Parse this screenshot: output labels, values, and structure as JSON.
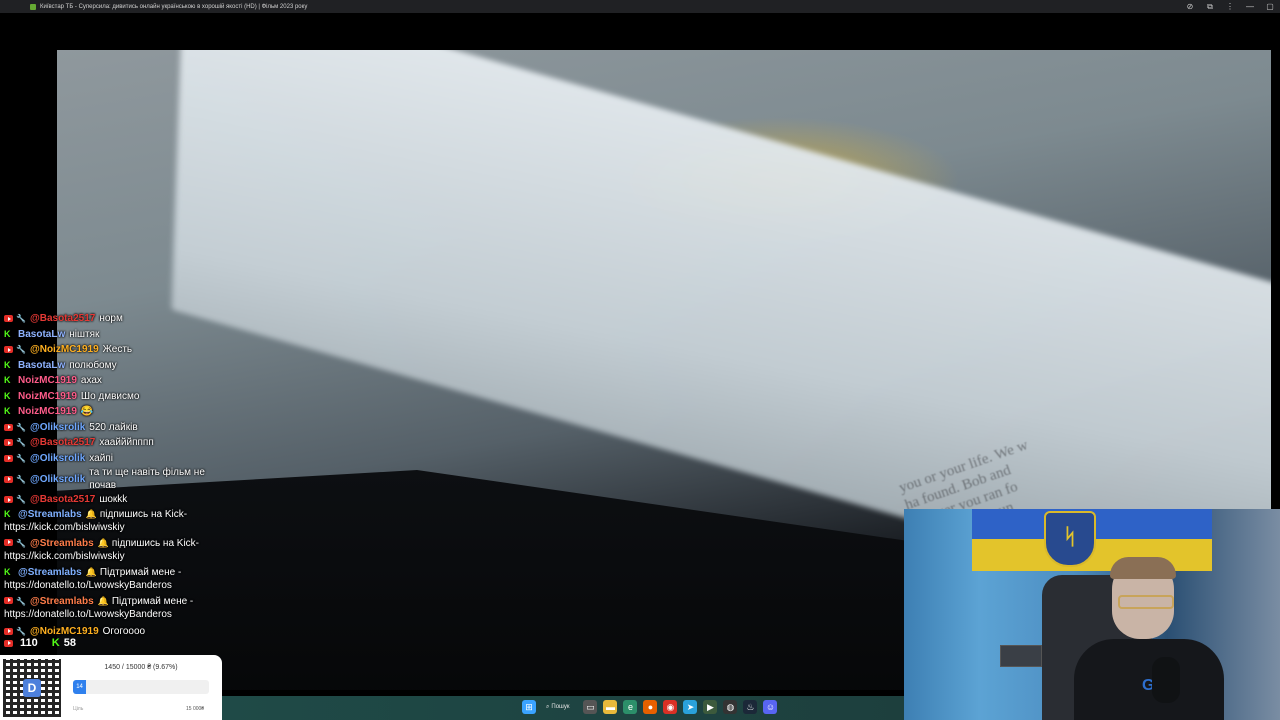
{
  "window": {
    "title": "Київстар ТБ - Суперсила: дивитись онлайн українською в хорошій якості (HD) | Фільм 2023 року",
    "controls": [
      "⊘",
      "⧉",
      "⋮",
      "—",
      "▢"
    ]
  },
  "video": {
    "book_text_lines": [
      "you or your life. We w",
      "ha found. Bob and",
      "ysauger you ran fo",
      "Mangi and maun"
    ]
  },
  "chat": {
    "messages": [
      {
        "source": "youtube",
        "user": "@Basota2517",
        "text": "норм"
      },
      {
        "source": "kick",
        "user": "BasotaLw",
        "text": "ніштяк"
      },
      {
        "source": "youtube",
        "user": "@NoizMC1919",
        "text": "Жесть"
      },
      {
        "source": "kick",
        "user": "BasotaLw",
        "text": "полюбому"
      },
      {
        "source": "kick",
        "user": "NoizMC1919",
        "text": "ахах"
      },
      {
        "source": "kick",
        "user": "NoizMC1919",
        "text": "Шо дмвисмо"
      },
      {
        "source": "kick",
        "user": "NoizMC1919",
        "text": "😂"
      },
      {
        "source": "youtube",
        "user": "@Oliksrolik",
        "text": "520 лайків"
      },
      {
        "source": "youtube",
        "user": "@Basota2517",
        "text": "хаайййпппп"
      },
      {
        "source": "youtube",
        "user": "@Oliksrolik",
        "text": "хайпі"
      },
      {
        "source": "youtube",
        "user": "@Oliksrolik",
        "text": "та ти ще навіть фільм не почав"
      },
      {
        "source": "youtube",
        "user": "@Basota2517",
        "text": "шокkk"
      },
      {
        "source": "kick",
        "user": "@Streamlabs",
        "text": "підпишись на Kick- https://kick.com/bislwiwskiy"
      },
      {
        "source": "youtube",
        "user": "@Streamlabs",
        "text": "підпишись на Kick- https://kick.com/bislwiwskiy"
      },
      {
        "source": "kick",
        "user": "@Streamlabs",
        "text": "Підтримай мене - https://donatello.to/LwowskyBanderos"
      },
      {
        "source": "youtube",
        "user": "@Streamlabs",
        "text": "Підтримай мене - https://donatello.to/LwowskyBanderos"
      },
      {
        "source": "youtube",
        "user": "@NoizMC1919",
        "text": "Огогоооо"
      }
    ],
    "youtube_viewers": "110",
    "kick_viewers": "58"
  },
  "donation": {
    "goal_text": "1450 / 15000 ₴ (9.67%)",
    "progress_label": "14",
    "progress_fraction": 0.0967,
    "left_label": "Ціль",
    "right_label": "15 000₴"
  },
  "taskbar": {
    "search_label": "Пошук",
    "apps": [
      "windows-start",
      "search",
      "task-view",
      "file-explorer",
      "edge",
      "firefox",
      "chrome",
      "telegram",
      "terminal",
      "obs",
      "steam",
      "discord"
    ]
  },
  "webcam": {
    "shirt_logo": "GYG"
  }
}
